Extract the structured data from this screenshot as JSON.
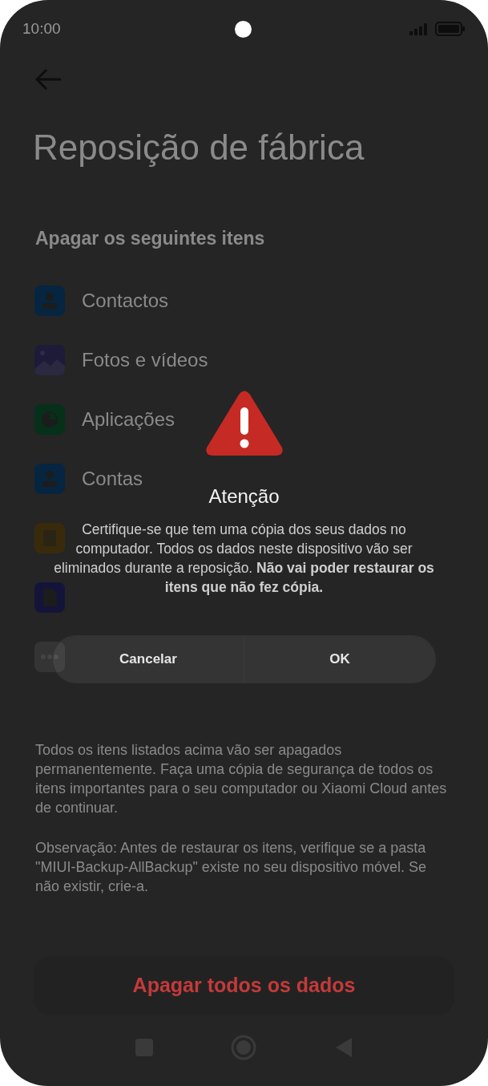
{
  "status_bar": {
    "time": "10:00"
  },
  "header": {
    "title": "Reposição de fábrica"
  },
  "section": {
    "heading": "Apagar os seguintes itens",
    "items": [
      {
        "kind": "contact",
        "label": "Contactos"
      },
      {
        "kind": "photo",
        "label": "Fotos e vídeos"
      },
      {
        "kind": "apps",
        "label": "Aplicações"
      },
      {
        "kind": "account",
        "label": "Contas"
      },
      {
        "kind": "backup"
      },
      {
        "kind": "file"
      },
      {
        "kind": "more"
      }
    ]
  },
  "notes": [
    "Todos os itens listados acima vão ser apagados permanentemente. Faça uma cópia de segurança de todos os itens importantes para o seu computador ou Xiaomi Cloud antes de continuar.",
    "Observação: Antes de restaurar os itens, verifique se a pasta \"MIUI-Backup-AllBackup\" existe no seu dispositivo móvel. Se não existir, crie-a."
  ],
  "action_button": {
    "label": "Apagar todos os dados"
  },
  "dialog": {
    "title": "Atenção",
    "message": "Certifique-se que tem uma cópia dos seus dados no computador. Todos os dados neste dispositivo vão ser eliminados durante a reposição. **Não vai poder restaurar os itens que não fez cópia.**",
    "buttons": [
      "Cancelar",
      "OK"
    ]
  }
}
